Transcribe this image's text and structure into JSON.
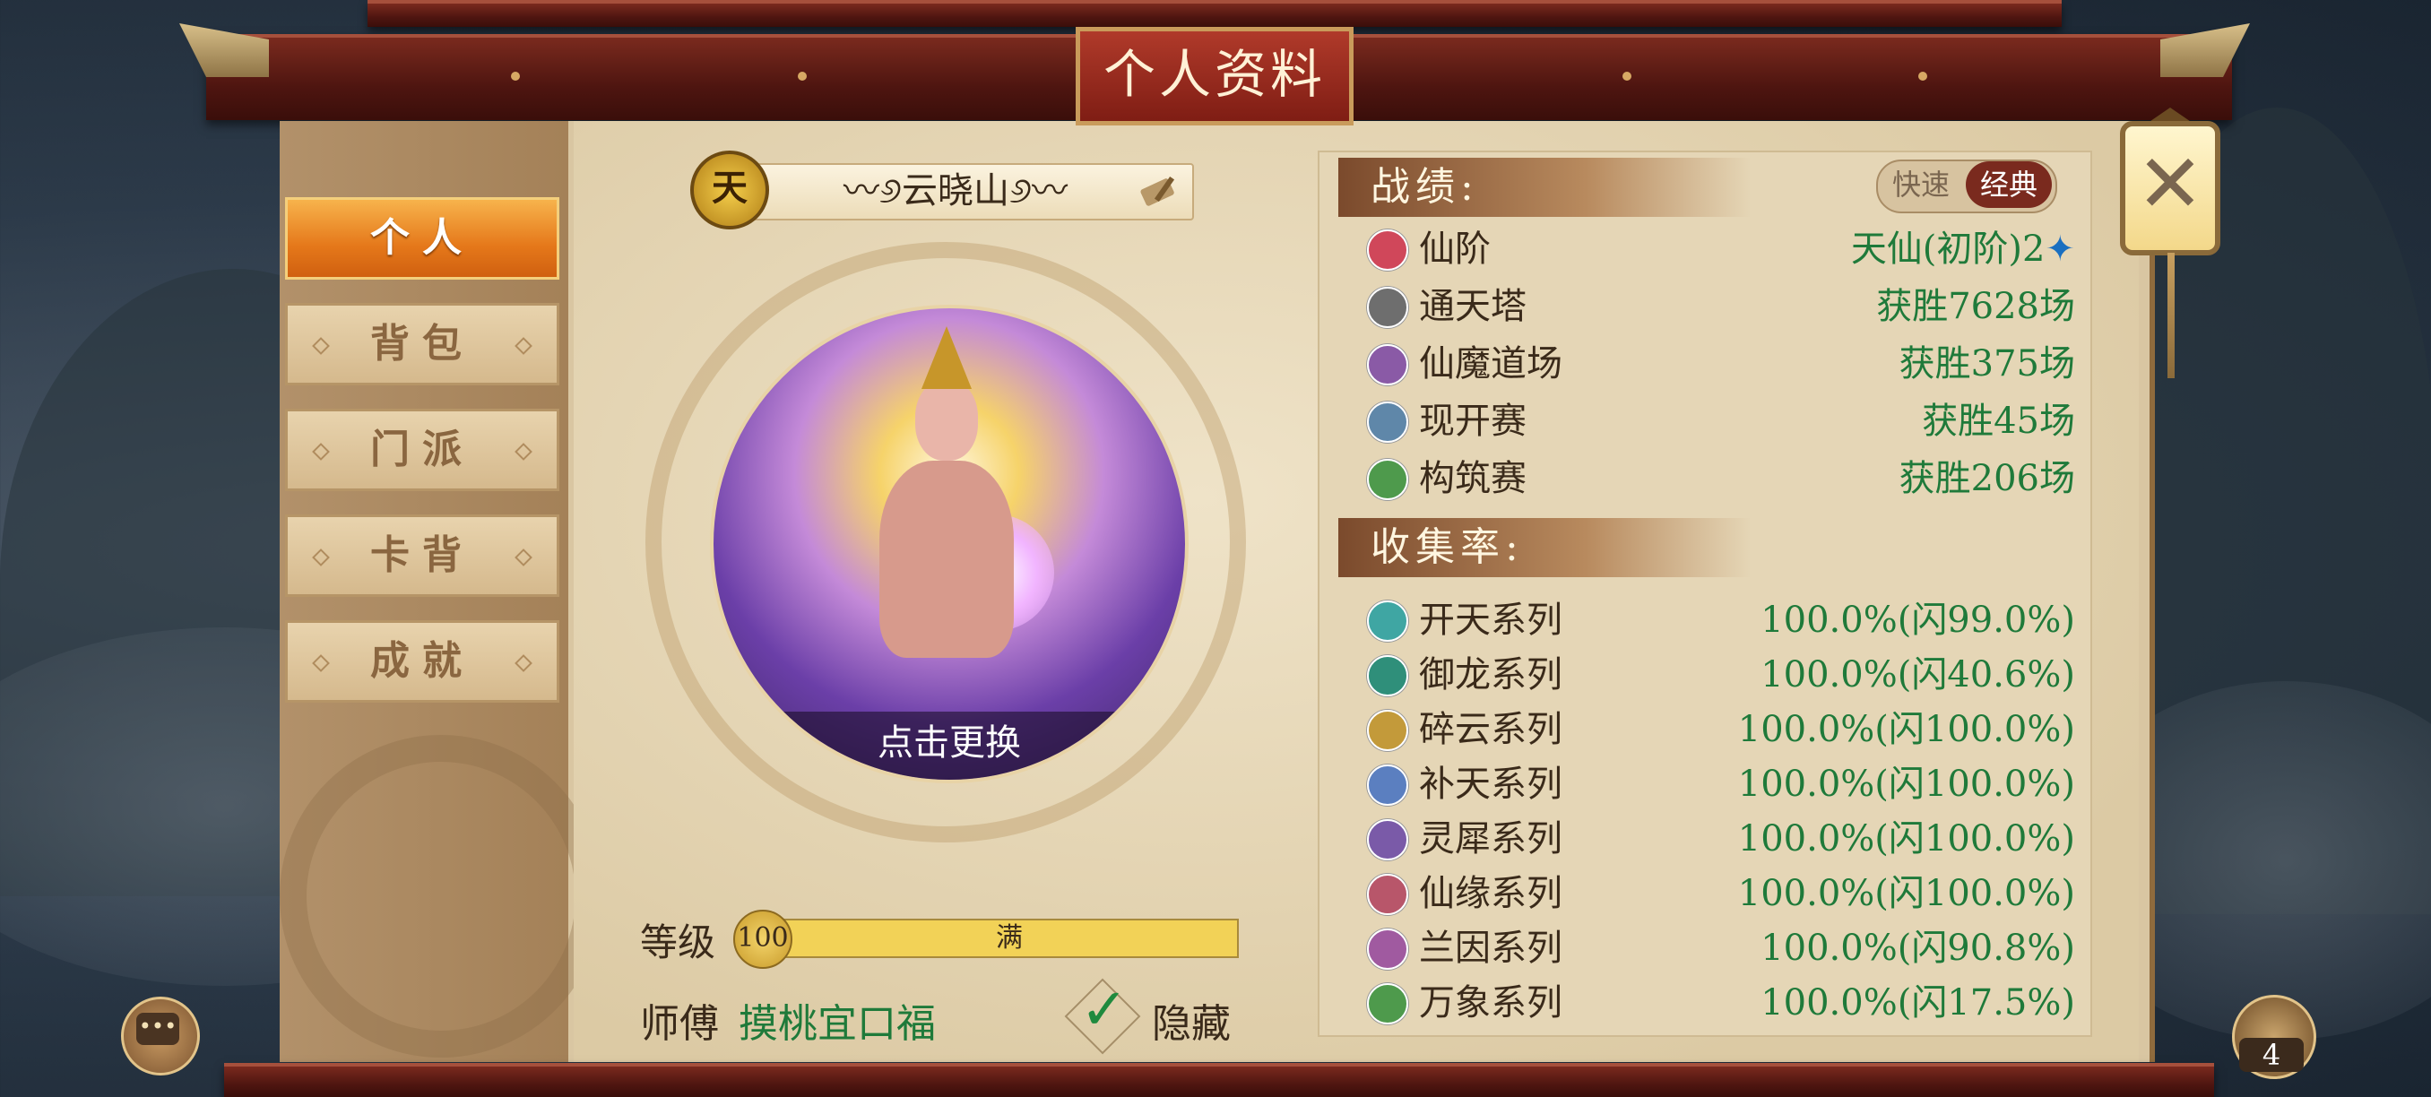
{
  "title": "个人资料",
  "tabs": [
    "个人",
    "背包",
    "门派",
    "卡背",
    "成就"
  ],
  "profile": {
    "rank_badge": "天",
    "name": "〰୬云晓山୬〰",
    "avatar_caption": "点击更换",
    "level_label": "等级",
    "level_value": "100",
    "level_bar_text": "满",
    "level_progress": 1.0,
    "master_label": "师傅",
    "master_name": "摸桃宜口福",
    "hide_label": "隐藏",
    "hide_checked": true
  },
  "record": {
    "heading": "战绩:",
    "mode_fast": "快速",
    "mode_classic": "经典",
    "rows": [
      {
        "icon": "star-icon",
        "color": "#d0475a",
        "label": "仙阶",
        "value": "天仙(初阶)2",
        "suffix": "✦"
      },
      {
        "icon": "tower-icon",
        "color": "#6e6e6e",
        "label": "通天塔",
        "value": "获胜7628场"
      },
      {
        "icon": "bird-icon",
        "color": "#8a5aa6",
        "label": "仙魔道场",
        "value": "获胜375场"
      },
      {
        "icon": "magnifier-icon",
        "color": "#5f87a9",
        "label": "现开赛",
        "value": "获胜45场"
      },
      {
        "icon": "leaf-icon",
        "color": "#4e9a4c",
        "label": "构筑赛",
        "value": "获胜206场"
      }
    ]
  },
  "collection": {
    "heading": "收集率:",
    "rows": [
      {
        "icon": "sprout-icon",
        "color": "#3fa6a3",
        "label": "开天系列",
        "value": "100.0%(闪99.0%)"
      },
      {
        "icon": "dragon-icon",
        "color": "#2f8f7a",
        "label": "御龙系列",
        "value": "100.0%(闪40.6%)"
      },
      {
        "icon": "cloud-swirl-icon",
        "color": "#c39a3a",
        "label": "碎云系列",
        "value": "100.0%(闪100.0%)"
      },
      {
        "icon": "cloud-icon",
        "color": "#5b7fc0",
        "label": "补天系列",
        "value": "100.0%(闪100.0%)"
      },
      {
        "icon": "rhino-icon",
        "color": "#7a5aa8",
        "label": "灵犀系列",
        "value": "100.0%(闪100.0%)"
      },
      {
        "icon": "feather-icon",
        "color": "#b8566a",
        "label": "仙缘系列",
        "value": "100.0%(闪100.0%)"
      },
      {
        "icon": "orchid-icon",
        "color": "#a05aa0",
        "label": "兰因系列",
        "value": "100.0%(闪90.8%)"
      },
      {
        "icon": "leaf-icon",
        "color": "#4e9a4c",
        "label": "万象系列",
        "value": "100.0%(闪17.5%)"
      }
    ]
  },
  "chat_icon": "chat-icon",
  "bag_count": "4"
}
